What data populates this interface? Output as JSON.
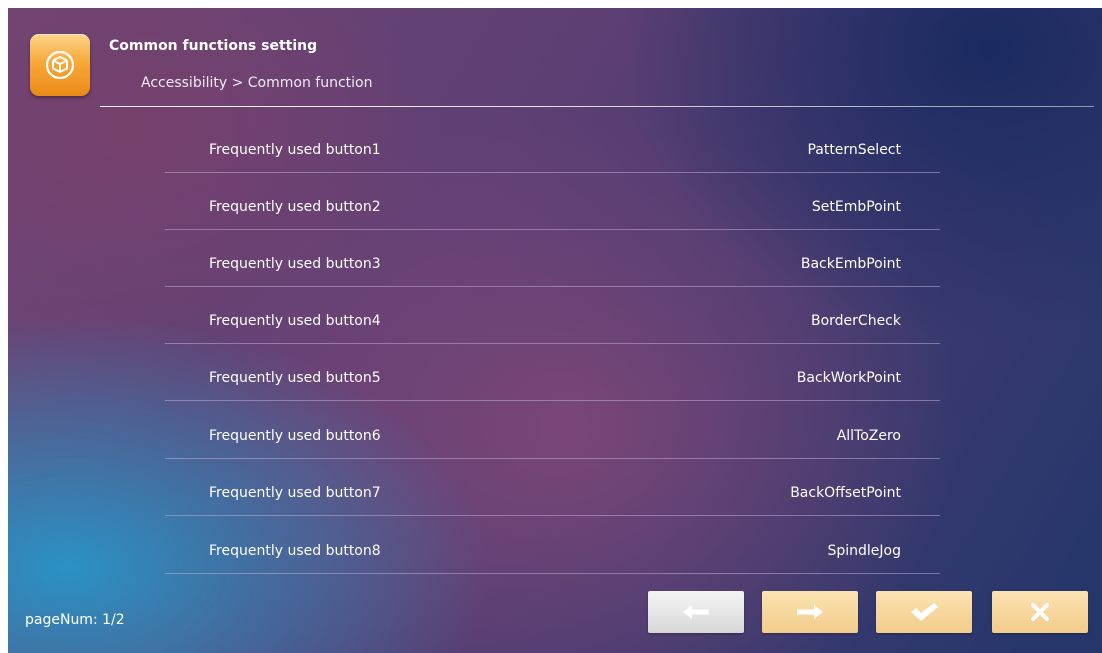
{
  "header": {
    "title": "Common functions setting",
    "breadcrumb": "Accessibility > Common function",
    "app_icon": "cube-icon",
    "accent_color": "#f7a93a"
  },
  "rows": [
    {
      "label": "Frequently used button1",
      "value": "PatternSelect"
    },
    {
      "label": "Frequently used button2",
      "value": "SetEmbPoint"
    },
    {
      "label": "Frequently used button3",
      "value": "BackEmbPoint"
    },
    {
      "label": "Frequently used button4",
      "value": "BorderCheck"
    },
    {
      "label": "Frequently used button5",
      "value": "BackWorkPoint"
    },
    {
      "label": "Frequently used button6",
      "value": "AllToZero"
    },
    {
      "label": "Frequently used button7",
      "value": "BackOffsetPoint"
    },
    {
      "label": "Frequently used button8",
      "value": "SpindleJog"
    }
  ],
  "footer": {
    "page_num": "pageNum: 1/2",
    "buttons": [
      {
        "icon": "arrow-left-icon",
        "state": "disabled"
      },
      {
        "icon": "arrow-right-icon",
        "state": "enabled"
      },
      {
        "icon": "checkmark-icon",
        "state": "enabled"
      },
      {
        "icon": "close-icon",
        "state": "enabled"
      }
    ]
  }
}
